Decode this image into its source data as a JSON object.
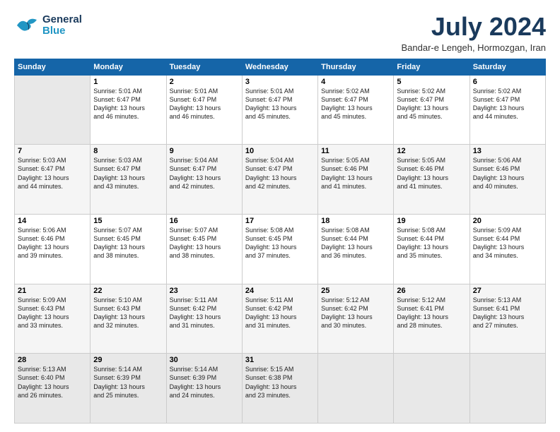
{
  "header": {
    "logo_line1": "General",
    "logo_line2": "Blue",
    "month_title": "July 2024",
    "subtitle": "Bandar-e Lengeh, Hormozgan, Iran"
  },
  "weekdays": [
    "Sunday",
    "Monday",
    "Tuesday",
    "Wednesday",
    "Thursday",
    "Friday",
    "Saturday"
  ],
  "weeks": [
    [
      {
        "day": "",
        "info": ""
      },
      {
        "day": "1",
        "info": "Sunrise: 5:01 AM\nSunset: 6:47 PM\nDaylight: 13 hours\nand 46 minutes."
      },
      {
        "day": "2",
        "info": "Sunrise: 5:01 AM\nSunset: 6:47 PM\nDaylight: 13 hours\nand 46 minutes."
      },
      {
        "day": "3",
        "info": "Sunrise: 5:01 AM\nSunset: 6:47 PM\nDaylight: 13 hours\nand 45 minutes."
      },
      {
        "day": "4",
        "info": "Sunrise: 5:02 AM\nSunset: 6:47 PM\nDaylight: 13 hours\nand 45 minutes."
      },
      {
        "day": "5",
        "info": "Sunrise: 5:02 AM\nSunset: 6:47 PM\nDaylight: 13 hours\nand 45 minutes."
      },
      {
        "day": "6",
        "info": "Sunrise: 5:02 AM\nSunset: 6:47 PM\nDaylight: 13 hours\nand 44 minutes."
      }
    ],
    [
      {
        "day": "7",
        "info": "Sunrise: 5:03 AM\nSunset: 6:47 PM\nDaylight: 13 hours\nand 44 minutes."
      },
      {
        "day": "8",
        "info": "Sunrise: 5:03 AM\nSunset: 6:47 PM\nDaylight: 13 hours\nand 43 minutes."
      },
      {
        "day": "9",
        "info": "Sunrise: 5:04 AM\nSunset: 6:47 PM\nDaylight: 13 hours\nand 42 minutes."
      },
      {
        "day": "10",
        "info": "Sunrise: 5:04 AM\nSunset: 6:47 PM\nDaylight: 13 hours\nand 42 minutes."
      },
      {
        "day": "11",
        "info": "Sunrise: 5:05 AM\nSunset: 6:46 PM\nDaylight: 13 hours\nand 41 minutes."
      },
      {
        "day": "12",
        "info": "Sunrise: 5:05 AM\nSunset: 6:46 PM\nDaylight: 13 hours\nand 41 minutes."
      },
      {
        "day": "13",
        "info": "Sunrise: 5:06 AM\nSunset: 6:46 PM\nDaylight: 13 hours\nand 40 minutes."
      }
    ],
    [
      {
        "day": "14",
        "info": "Sunrise: 5:06 AM\nSunset: 6:46 PM\nDaylight: 13 hours\nand 39 minutes."
      },
      {
        "day": "15",
        "info": "Sunrise: 5:07 AM\nSunset: 6:45 PM\nDaylight: 13 hours\nand 38 minutes."
      },
      {
        "day": "16",
        "info": "Sunrise: 5:07 AM\nSunset: 6:45 PM\nDaylight: 13 hours\nand 38 minutes."
      },
      {
        "day": "17",
        "info": "Sunrise: 5:08 AM\nSunset: 6:45 PM\nDaylight: 13 hours\nand 37 minutes."
      },
      {
        "day": "18",
        "info": "Sunrise: 5:08 AM\nSunset: 6:44 PM\nDaylight: 13 hours\nand 36 minutes."
      },
      {
        "day": "19",
        "info": "Sunrise: 5:08 AM\nSunset: 6:44 PM\nDaylight: 13 hours\nand 35 minutes."
      },
      {
        "day": "20",
        "info": "Sunrise: 5:09 AM\nSunset: 6:44 PM\nDaylight: 13 hours\nand 34 minutes."
      }
    ],
    [
      {
        "day": "21",
        "info": "Sunrise: 5:09 AM\nSunset: 6:43 PM\nDaylight: 13 hours\nand 33 minutes."
      },
      {
        "day": "22",
        "info": "Sunrise: 5:10 AM\nSunset: 6:43 PM\nDaylight: 13 hours\nand 32 minutes."
      },
      {
        "day": "23",
        "info": "Sunrise: 5:11 AM\nSunset: 6:42 PM\nDaylight: 13 hours\nand 31 minutes."
      },
      {
        "day": "24",
        "info": "Sunrise: 5:11 AM\nSunset: 6:42 PM\nDaylight: 13 hours\nand 31 minutes."
      },
      {
        "day": "25",
        "info": "Sunrise: 5:12 AM\nSunset: 6:42 PM\nDaylight: 13 hours\nand 30 minutes."
      },
      {
        "day": "26",
        "info": "Sunrise: 5:12 AM\nSunset: 6:41 PM\nDaylight: 13 hours\nand 28 minutes."
      },
      {
        "day": "27",
        "info": "Sunrise: 5:13 AM\nSunset: 6:41 PM\nDaylight: 13 hours\nand 27 minutes."
      }
    ],
    [
      {
        "day": "28",
        "info": "Sunrise: 5:13 AM\nSunset: 6:40 PM\nDaylight: 13 hours\nand 26 minutes."
      },
      {
        "day": "29",
        "info": "Sunrise: 5:14 AM\nSunset: 6:39 PM\nDaylight: 13 hours\nand 25 minutes."
      },
      {
        "day": "30",
        "info": "Sunrise: 5:14 AM\nSunset: 6:39 PM\nDaylight: 13 hours\nand 24 minutes."
      },
      {
        "day": "31",
        "info": "Sunrise: 5:15 AM\nSunset: 6:38 PM\nDaylight: 13 hours\nand 23 minutes."
      },
      {
        "day": "",
        "info": ""
      },
      {
        "day": "",
        "info": ""
      },
      {
        "day": "",
        "info": ""
      }
    ]
  ]
}
